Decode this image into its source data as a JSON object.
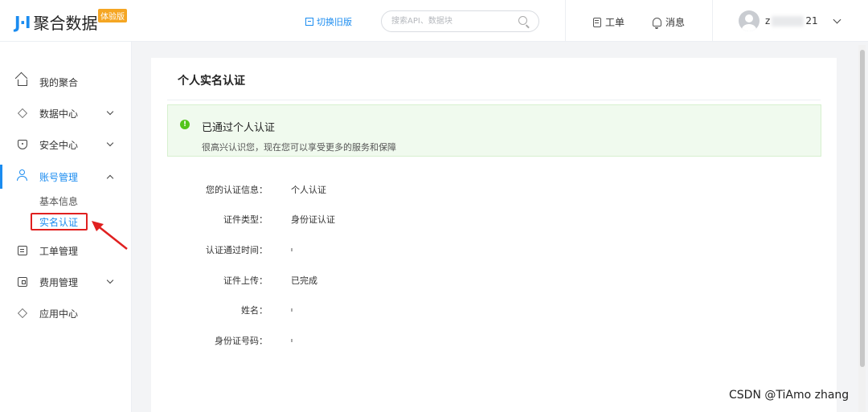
{
  "header": {
    "logo_mark": "J·I",
    "logo_text": "聚合数据",
    "beta_badge": "体验版",
    "switch_old_label": "切换旧版",
    "search_placeholder": "搜索API、数据块",
    "ticket_label": "工单",
    "message_label": "消息",
    "username_prefix": "z",
    "username_suffix": "21"
  },
  "sidebar": {
    "items": [
      {
        "label": "我的聚合",
        "icon": "home-icon"
      },
      {
        "label": "数据中心",
        "icon": "layers-icon"
      },
      {
        "label": "安全中心",
        "icon": "shield-icon"
      },
      {
        "label": "账号管理",
        "icon": "user-icon"
      },
      {
        "label": "工单管理",
        "icon": "doc-icon"
      },
      {
        "label": "费用管理",
        "icon": "wallet-icon"
      },
      {
        "label": "应用中心",
        "icon": "layers-icon"
      }
    ],
    "sub_items": [
      "基本信息",
      "实名认证"
    ]
  },
  "main": {
    "title": "个人实名认证",
    "success_title": "已通过个人认证",
    "success_desc": "很高兴认识您，现在您可以享受更多的服务和保障",
    "rows": [
      {
        "label": "您的认证信息：",
        "value": "个人认证"
      },
      {
        "label": "证件类型：",
        "value": "身份证认证"
      },
      {
        "label": "认证通过时间：",
        "value": ""
      },
      {
        "label": "证件上传：",
        "value": "已完成"
      },
      {
        "label": "姓名：",
        "value": ""
      },
      {
        "label": "身份证号码：",
        "value": ""
      }
    ]
  },
  "watermark": "CSDN @TiAmo zhang",
  "colors": {
    "accent": "#1b8cf0",
    "success": "#52c41a",
    "annotation": "#e02020",
    "badge": "#f5a623"
  }
}
